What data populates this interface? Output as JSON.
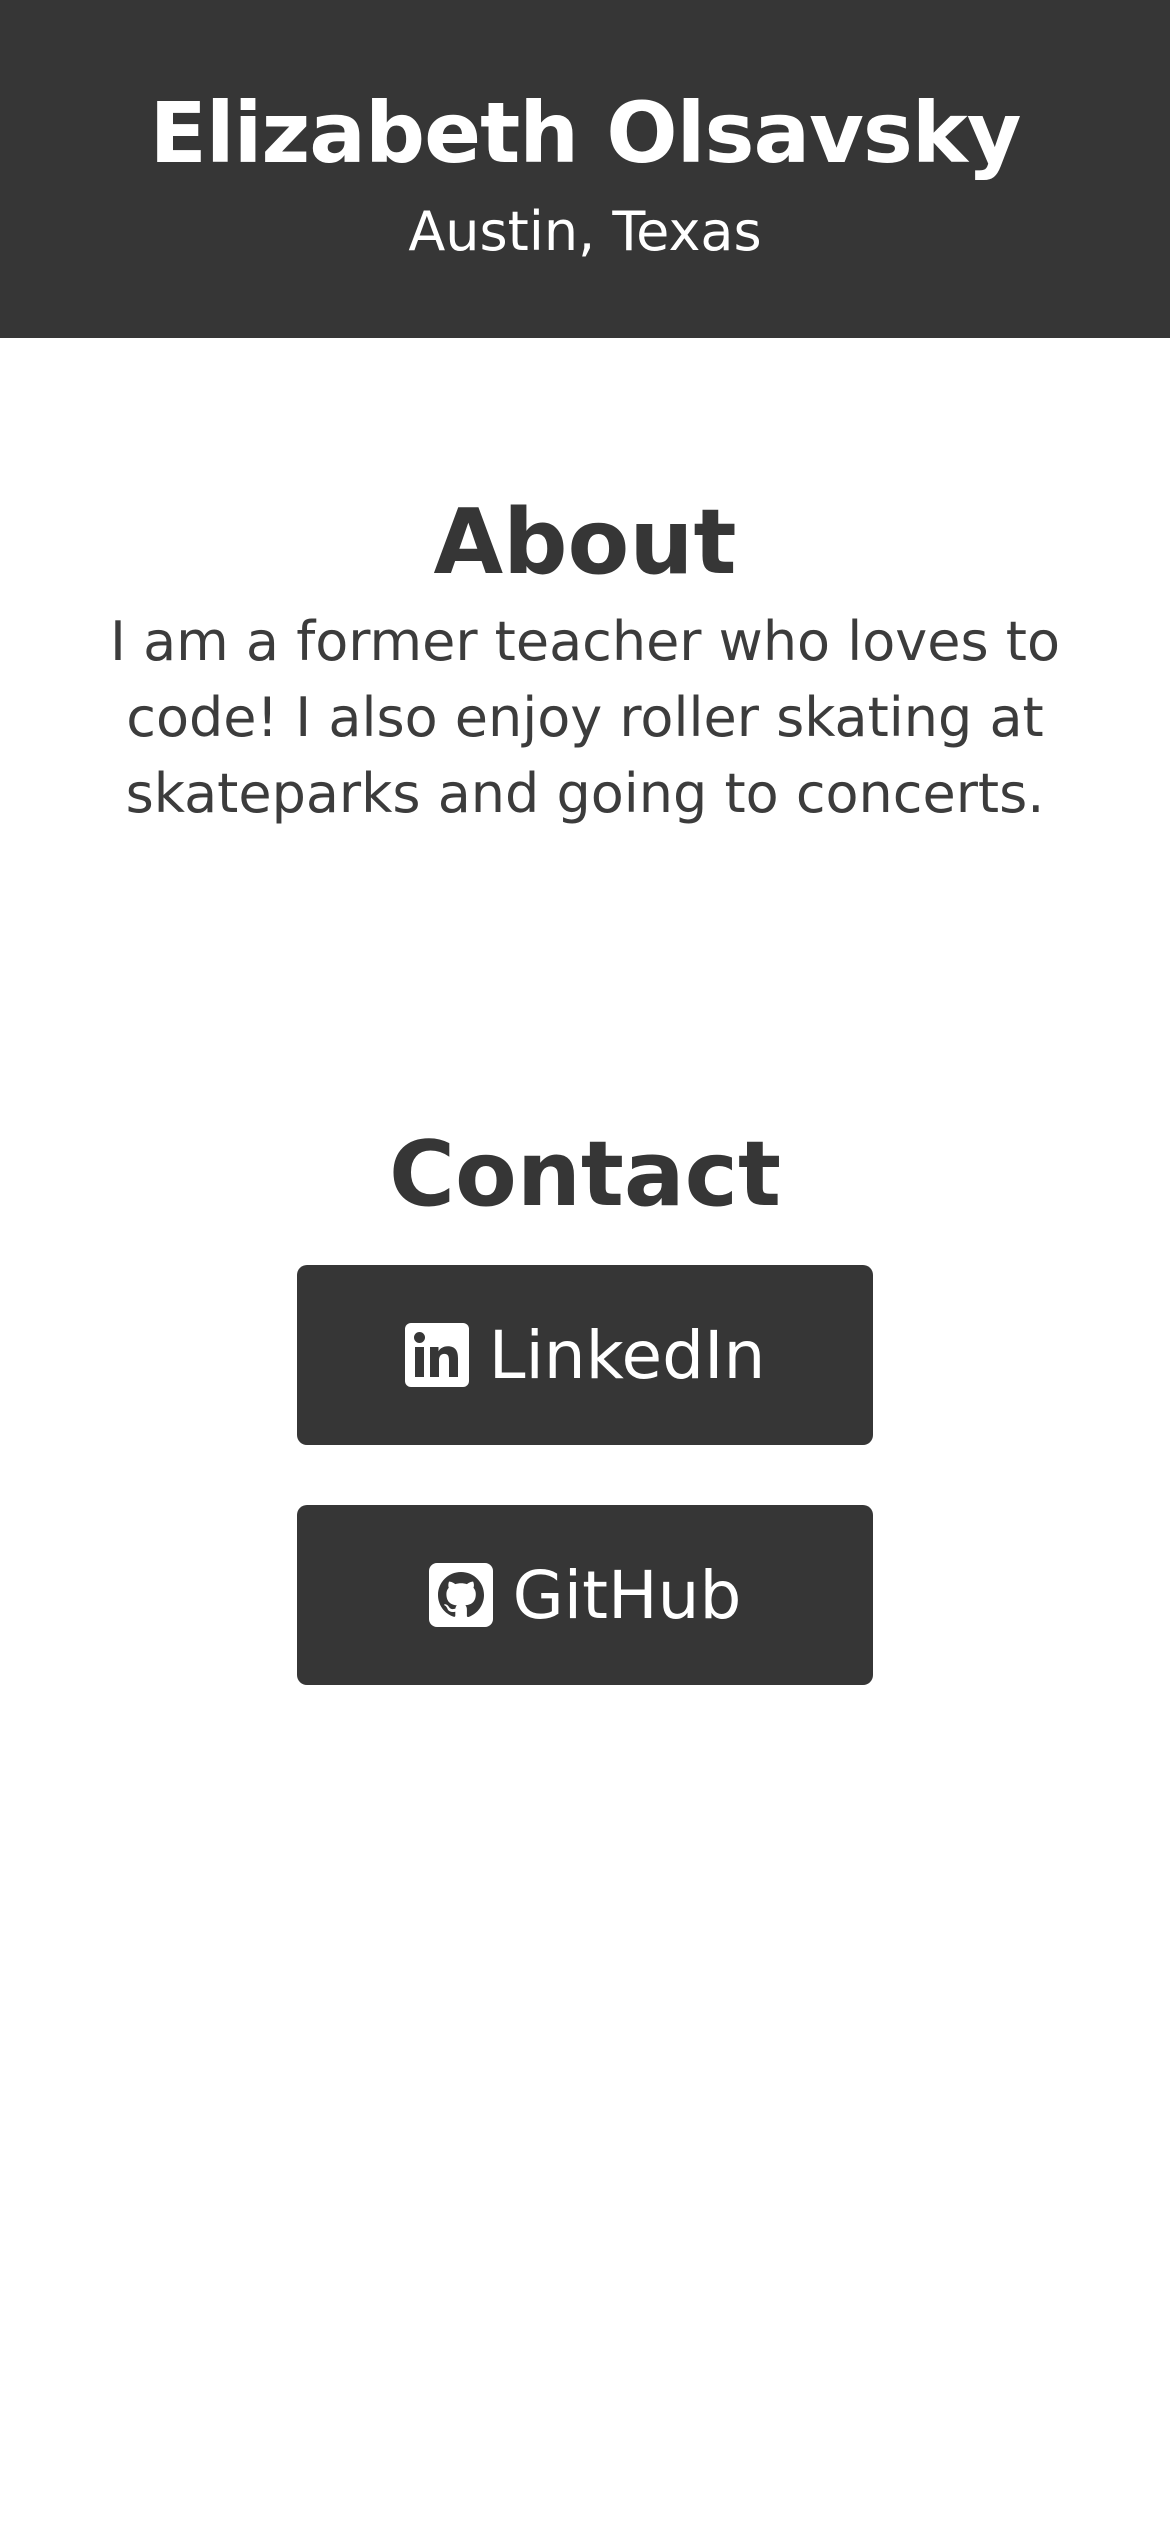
{
  "header": {
    "name": "Elizabeth Olsavsky",
    "location": "Austin, Texas"
  },
  "about": {
    "title": "About",
    "text": "I am a former teacher who loves to code! I also enjoy roller skating at skateparks and going to concerts."
  },
  "contact": {
    "title": "Contact",
    "buttons": [
      {
        "label": "LinkedIn",
        "icon": "linkedin-icon"
      },
      {
        "label": "GitHub",
        "icon": "github-icon"
      }
    ]
  },
  "colors": {
    "dark": "#363636",
    "background": "#ffffff",
    "text_light": "#ffffff"
  }
}
